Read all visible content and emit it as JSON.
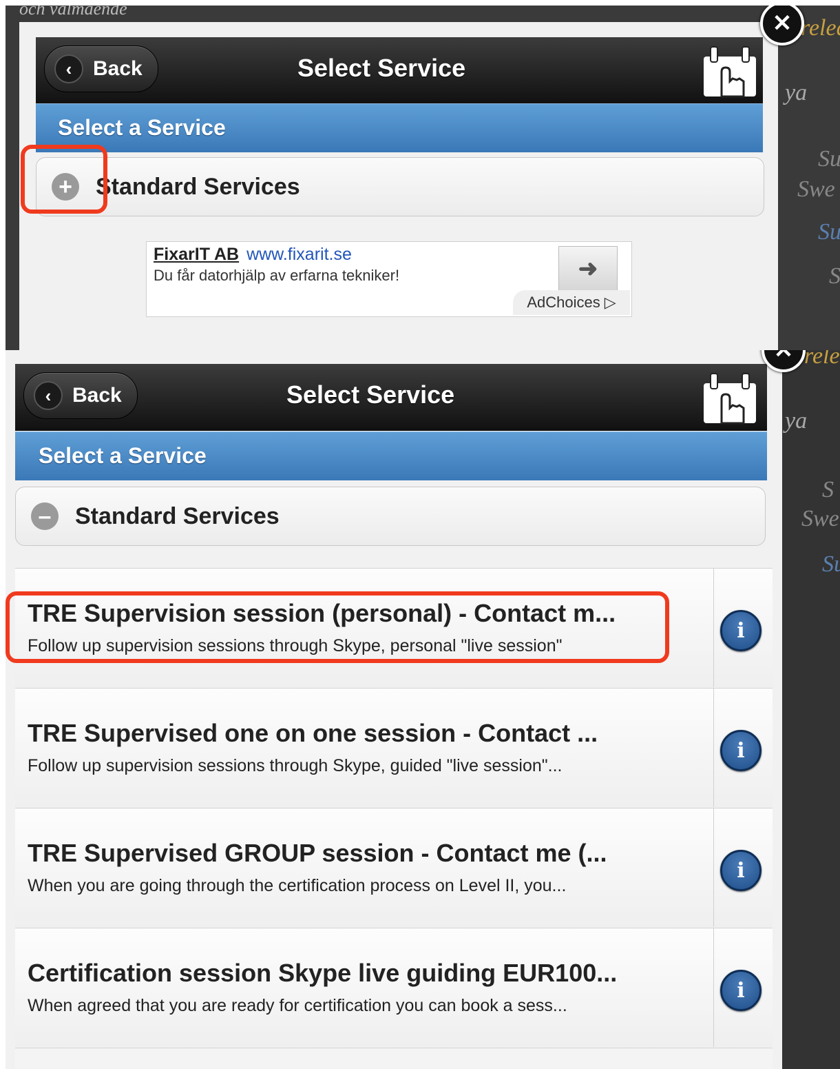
{
  "top_screen": {
    "header": {
      "back_label": "Back",
      "title": "Select Service",
      "logo_icon": "hand-calendar-logo-icon"
    },
    "section_bar": "Select a Service",
    "collapsible": {
      "label": "Standard Services",
      "state": "collapsed",
      "icon": "plus-circle-icon"
    },
    "ad": {
      "advertiser": "FixarIT AB",
      "url": "www.fixarit.se",
      "text": "Du får datorhjälp av erfarna tekniker!",
      "arrow_icon": "arrow-right-icon",
      "adchoices": "AdChoices"
    },
    "background_text": {
      "top": "och valmaende",
      "right_1": "releas",
      "right_2": "ya",
      "right_3": "Su",
      "right_4": "Swe",
      "right_5": "Su",
      "right_6": "S"
    }
  },
  "bottom_screen": {
    "header": {
      "back_label": "Back",
      "title": "Select Service",
      "logo_icon": "hand-calendar-logo-icon"
    },
    "section_bar": "Select a Service",
    "collapsible": {
      "label": "Standard Services",
      "state": "expanded",
      "icon": "minus-circle-icon"
    },
    "services": [
      {
        "title": "TRE Supervision session (personal) - Contact m...",
        "description": "Follow up supervision sessions through Skype, personal \"live session\""
      },
      {
        "title": "TRE Supervised one on one session - Contact ...",
        "description": "Follow up supervision sessions through Skype, guided \"live session\"..."
      },
      {
        "title": "TRE Supervised GROUP session - Contact me (...",
        "description": "When you are going through the certification process on Level II, you..."
      },
      {
        "title": "Certification session Skype live guiding EUR100...",
        "description": "When agreed that you are ready for certification you can book a sess..."
      }
    ],
    "background_text": {
      "right_1": "releas",
      "right_2": "ya",
      "right_3": "S",
      "right_4": "Swe",
      "right_5": "Su"
    }
  },
  "colors": {
    "highlight": "#f03a1e",
    "section_blue": "#4a8ac8",
    "info_blue": "#2a5c98"
  }
}
